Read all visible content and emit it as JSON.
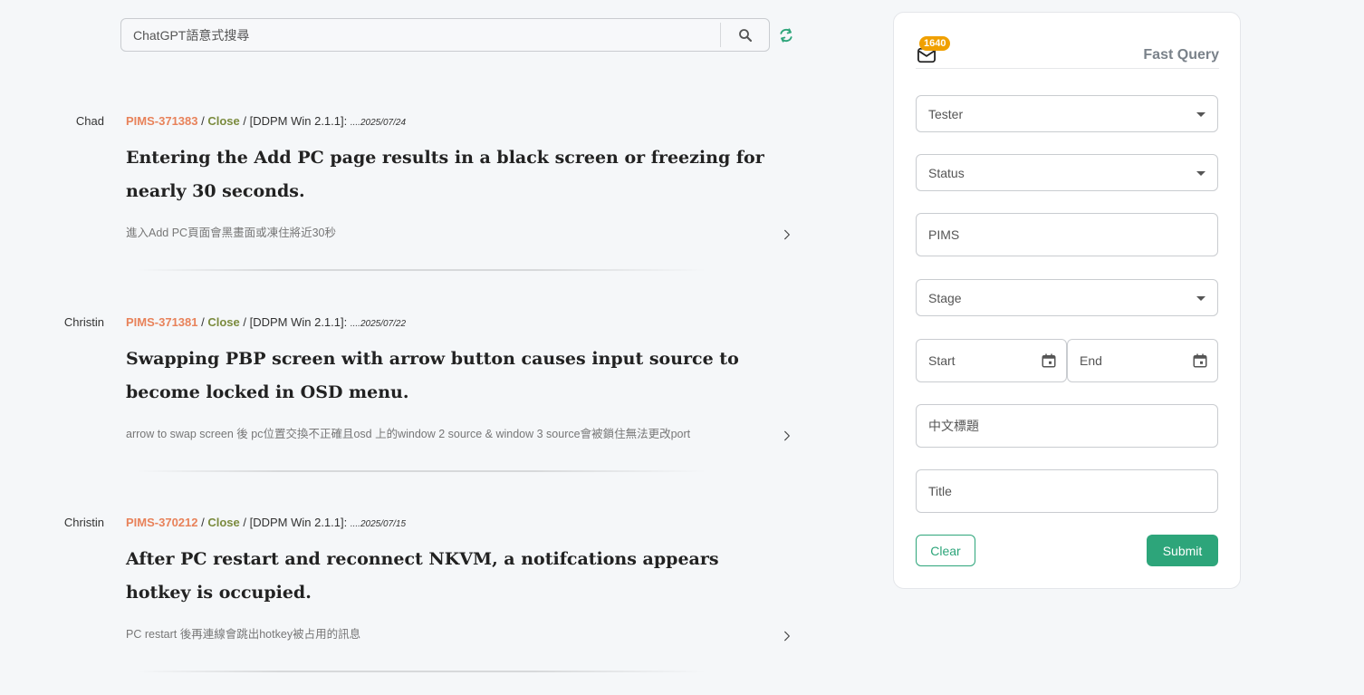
{
  "search": {
    "placeholder": "ChatGPT語意式搜尋"
  },
  "issues": [
    {
      "owner": "Chad",
      "pims": "PIMS-371383",
      "sep1": " / ",
      "status": "Close",
      "sep2": " / [DDPM Win 2.1.1]: ",
      "date": "....2025/07/24",
      "title": "Entering the Add PC page results in a black screen or freezing for nearly 30 seconds.",
      "desc": "進入Add PC頁面會黑畫面或凍住將近30秒"
    },
    {
      "owner": "Christin",
      "pims": "PIMS-371381",
      "sep1": " / ",
      "status": "Close",
      "sep2": " / [DDPM Win 2.1.1]: ",
      "date": "....2025/07/22",
      "title": "Swapping PBP screen with arrow button causes input source to become locked in OSD menu.",
      "desc": "arrow to swap screen 後 pc位置交換不正確且osd 上的window 2 source & window 3 source會被鎖住無法更改port"
    },
    {
      "owner": "Christin",
      "pims": "PIMS-370212",
      "sep1": " / ",
      "status": "Close",
      "sep2": " / [DDPM Win 2.1.1]: ",
      "date": "....2025/07/15",
      "title": "After PC restart and reconnect NKVM, a notifcations appears hotkey is occupied.",
      "desc": "PC restart 後再連線會跳出hotkey被占用的訊息"
    }
  ],
  "panel": {
    "badge": "1640",
    "title": "Fast Query",
    "tester": "Tester",
    "status": "Status",
    "pims": "PIMS",
    "stage": "Stage",
    "start": "Start",
    "end": "End",
    "chinese_title": "中文標題",
    "title_field": "Title",
    "clear": "Clear",
    "submit": "Submit"
  },
  "colors": {
    "accent": "#2da57a",
    "pims": "#e8825a",
    "status": "#7b8b3e",
    "badge": "#f0a000"
  }
}
